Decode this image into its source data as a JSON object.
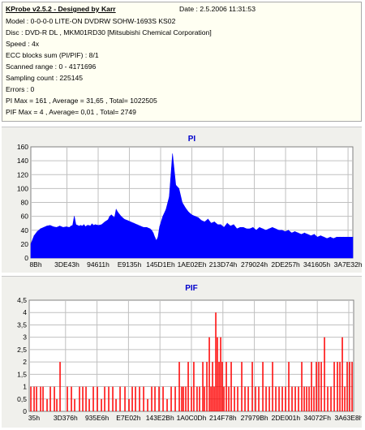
{
  "header": {
    "title": "KProbe v2.5.2 - Designed by Karr",
    "date": "Date : 2.5.2006 11:31:53",
    "lines": [
      "Model : 0-0-0-0 LITE-ON DVDRW SOHW-1693S KS02",
      "Disc : DVD-R DL , MKM01RD30 [Mitsubishi Chemical Corporation]",
      "Speed : 4x",
      "ECC blocks sum (PI/PIF) : 8/1",
      "Scanned range : 0 - 4171696",
      "Sampling count : 225145",
      "Errors : 0",
      "PI Max = 161 , Average = 31,65 , Total= 1022505",
      "PIF Max = 4 , Average= 0,01 , Total= 2749"
    ]
  },
  "colors": {
    "pi_fill": "#0000ff",
    "pif_bar": "#ff0000",
    "grid": "#c0c0c0",
    "plot_bg": "#ffffff",
    "title": "#0000cc"
  },
  "chart_data": [
    {
      "type": "area",
      "title": "PI",
      "ylim": [
        0,
        160
      ],
      "yticks": [
        "0",
        "20",
        "40",
        "60",
        "80",
        "100",
        "120",
        "140",
        "160"
      ],
      "xticks": [
        "8Bh",
        "3DE43h",
        "94611h",
        "E9135h",
        "145D1Eh",
        "1AE02Eh",
        "213D74h",
        "279024h",
        "2DE257h",
        "341605h",
        "3A7E32h"
      ],
      "x": [
        0,
        4,
        8,
        12,
        16,
        20,
        24,
        28,
        32,
        36,
        40,
        44,
        48,
        50,
        52,
        54,
        56,
        58,
        60,
        62,
        64,
        66,
        68,
        70,
        72,
        74,
        76,
        78,
        80,
        84,
        88,
        92,
        96,
        98,
        100,
        104,
        106,
        108,
        112,
        116,
        120,
        124,
        128,
        132,
        136,
        140,
        144,
        148,
        150,
        152,
        154,
        156,
        158,
        160,
        164,
        168,
        172,
        176,
        180,
        184,
        188,
        192,
        196,
        200,
        204,
        208,
        212,
        216,
        220,
        224,
        228,
        232,
        236,
        240,
        244,
        248,
        252,
        256,
        260,
        264,
        268,
        272,
        276,
        280,
        284,
        288,
        292,
        296,
        300,
        304,
        308,
        312,
        316,
        320,
        324,
        328,
        332,
        336,
        340,
        344,
        348,
        352,
        356,
        360,
        364,
        368,
        372,
        376,
        380,
        384,
        388,
        392,
        396,
        400
      ],
      "values": [
        20,
        32,
        38,
        42,
        44,
        46,
        47,
        45,
        44,
        46,
        44,
        45,
        44,
        46,
        47,
        60,
        48,
        47,
        46,
        47,
        46,
        48,
        45,
        47,
        47,
        46,
        49,
        47,
        48,
        47,
        48,
        52,
        55,
        60,
        62,
        58,
        70,
        66,
        60,
        56,
        54,
        52,
        50,
        48,
        46,
        44,
        44,
        42,
        40,
        36,
        30,
        25,
        30,
        45,
        60,
        70,
        88,
        150,
        105,
        100,
        80,
        72,
        66,
        62,
        60,
        58,
        54,
        52,
        56,
        50,
        52,
        48,
        48,
        44,
        50,
        46,
        48,
        42,
        44,
        44,
        42,
        42,
        44,
        40,
        44,
        42,
        40,
        42,
        44,
        42,
        40,
        40,
        38,
        40,
        36,
        38,
        36,
        34,
        36,
        34,
        32,
        34,
        30,
        32,
        30,
        28,
        30,
        28,
        30,
        30,
        30,
        30,
        30,
        30
      ]
    },
    {
      "type": "bar",
      "title": "PIF",
      "ylim": [
        0,
        4.5
      ],
      "yticks": [
        "0",
        "0,5",
        "1",
        "1,5",
        "2",
        "2,5",
        "3",
        "3,5",
        "4",
        "4,5"
      ],
      "xticks": [
        "35h",
        "3D376h",
        "935E6h",
        "E7E02h",
        "143E2Bh",
        "1A0C0Dh",
        "214F78h",
        "27979Bh",
        "2DE001h",
        "34072Fh",
        "3A63E8h"
      ],
      "x": [
        2,
        6,
        9,
        14,
        17,
        22,
        26,
        31,
        34,
        38,
        47,
        52,
        56,
        62,
        66,
        70,
        74,
        79,
        84,
        89,
        93,
        98,
        103,
        107,
        112,
        118,
        123,
        127,
        131,
        136,
        141,
        146,
        151,
        155,
        160,
        165,
        170,
        175,
        180,
        185,
        188,
        190,
        193,
        196,
        200,
        203,
        207,
        210,
        214,
        216,
        219,
        222,
        224,
        226,
        228,
        230,
        232,
        234,
        236,
        238,
        240,
        243,
        246,
        249,
        253,
        257,
        262,
        266,
        270,
        275,
        279,
        283,
        288,
        292,
        296,
        300,
        304,
        308,
        312,
        316,
        320,
        324,
        328,
        332,
        336,
        339,
        342,
        345,
        348,
        351,
        354,
        357,
        360,
        364,
        368,
        372,
        376,
        380,
        383,
        386,
        389,
        392,
        395,
        398
      ],
      "values": [
        1,
        1,
        1,
        1,
        1,
        0.5,
        1,
        1,
        0.5,
        2,
        1,
        1,
        0.5,
        1,
        1,
        1,
        0.5,
        1,
        1,
        0.5,
        1,
        1,
        1,
        0.5,
        1,
        1,
        0.5,
        1,
        1,
        1,
        1,
        0.5,
        1,
        1,
        1,
        1,
        0.5,
        1,
        1,
        2,
        1,
        1,
        1,
        2,
        1,
        2,
        1,
        1,
        2,
        1,
        2,
        3,
        1,
        2,
        1,
        4,
        3,
        2,
        3,
        2,
        1,
        2,
        1,
        2,
        1,
        1,
        2,
        1,
        1,
        2,
        1,
        1,
        2,
        1,
        1,
        2,
        1,
        1,
        1,
        1,
        2,
        1,
        1,
        1,
        2,
        1,
        1,
        1,
        2,
        1,
        2,
        2,
        2,
        3,
        1,
        1,
        2,
        2,
        2,
        3,
        1,
        2,
        2,
        2
      ]
    }
  ]
}
